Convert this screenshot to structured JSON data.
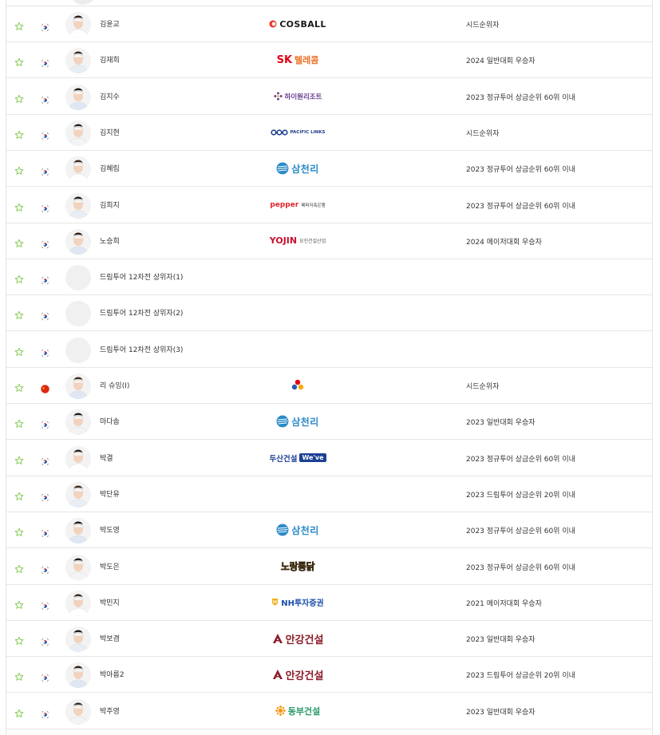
{
  "colors": {
    "border": "#e6e6e6",
    "star_green": "#7cc94a",
    "korea_red": "#cd2e3a",
    "korea_blue": "#0047a0",
    "china_red": "#de2910"
  },
  "players": [
    {
      "name": "김윤교",
      "flag": "korea",
      "avatar": "photo",
      "sponsor": {
        "logo": "cosball",
        "text": "COSBALL",
        "color": "#1a1a1a",
        "accent": "#e6332a"
      },
      "qualification": "시드순위자"
    },
    {
      "name": "김재희",
      "flag": "korea",
      "avatar": "photo",
      "sponsor": {
        "logo": "sk-telecom",
        "text": "텔레콤",
        "prefix": "SK",
        "color": "#ea7125",
        "accent": "#e50012"
      },
      "qualification": "2024 일반대회 우승자"
    },
    {
      "name": "김지수",
      "flag": "korea",
      "avatar": "photo",
      "sponsor": {
        "logo": "high1",
        "text": "하이원리조트",
        "color": "#6b3d8f",
        "accent": "#6b3d8f"
      },
      "qualification": "2023 정규투어 상금순위 60위 이내"
    },
    {
      "name": "김지현",
      "flag": "korea",
      "avatar": "photo",
      "sponsor": {
        "logo": "pacific-links",
        "text": "PACIFIC LINKS",
        "color": "#1e3f8a",
        "accent": "#1e3f8a"
      },
      "qualification": "시드순위자"
    },
    {
      "name": "김혜림",
      "flag": "korea",
      "avatar": "photo",
      "sponsor": {
        "logo": "samchully",
        "text": "삼천리",
        "color": "#2a8bc8",
        "accent": "#2a8bc8"
      },
      "qualification": "2023 정규투어 상금순위 60위 이내"
    },
    {
      "name": "김희지",
      "flag": "korea",
      "avatar": "photo",
      "sponsor": {
        "logo": "pepper",
        "text": "pepper",
        "suffix": "페퍼저축은행",
        "color": "#e0262d",
        "accent": "#333333"
      },
      "qualification": "2023 정규투어 상금순위 60위 이내"
    },
    {
      "name": "노승희",
      "flag": "korea",
      "avatar": "photo",
      "sponsor": {
        "logo": "yojin",
        "text": "YOJIN",
        "suffix": "요진건설산업",
        "color": "#c8102e",
        "accent": "#555555"
      },
      "qualification": "2024 메이저대회 우승자"
    },
    {
      "name": "드림투어 12차전 상위자(1)",
      "flag": "korea",
      "avatar": "blank",
      "sponsor": {
        "logo": "none",
        "text": ""
      },
      "qualification": ""
    },
    {
      "name": "드림투어 12차전 상위자(2)",
      "flag": "korea",
      "avatar": "blank",
      "sponsor": {
        "logo": "none",
        "text": ""
      },
      "qualification": ""
    },
    {
      "name": "드림투어 12차전 상위자(3)",
      "flag": "korea",
      "avatar": "blank",
      "sponsor": {
        "logo": "none",
        "text": ""
      },
      "qualification": ""
    },
    {
      "name": "리 슈잉(I)",
      "flag": "china",
      "avatar": "photo",
      "sponsor": {
        "logo": "cj",
        "text": "",
        "color": "#e50012",
        "accent": "#f9a800"
      },
      "qualification": "시드순위자"
    },
    {
      "name": "마다솜",
      "flag": "korea",
      "avatar": "photo",
      "sponsor": {
        "logo": "samchully",
        "text": "삼천리",
        "color": "#2a8bc8",
        "accent": "#2a8bc8"
      },
      "qualification": "2023 일반대회 우승자"
    },
    {
      "name": "박결",
      "flag": "korea",
      "avatar": "photo",
      "sponsor": {
        "logo": "doosan-weve",
        "text": "두산건설",
        "suffix": "We've",
        "color": "#1c3f94",
        "accent": "#1c3f94"
      },
      "qualification": "2023 정규투어 상금순위 60위 이내"
    },
    {
      "name": "박단유",
      "flag": "korea",
      "avatar": "photo",
      "sponsor": {
        "logo": "none",
        "text": ""
      },
      "qualification": "2023 드림투어 상금순위 20위 이내"
    },
    {
      "name": "박도영",
      "flag": "korea",
      "avatar": "photo",
      "sponsor": {
        "logo": "samchully",
        "text": "삼천리",
        "color": "#2a8bc8",
        "accent": "#2a8bc8"
      },
      "qualification": "2023 정규투어 상금순위 60위 이내"
    },
    {
      "name": "박도은",
      "flag": "korea",
      "avatar": "photo",
      "sponsor": {
        "logo": "noranggotong",
        "text": "노랑통닭",
        "color": "#f6d21e",
        "accent": "#3a2a10"
      },
      "qualification": "2023 정규투어 상금순위 60위 이내"
    },
    {
      "name": "박민지",
      "flag": "korea",
      "avatar": "photo",
      "sponsor": {
        "logo": "nh",
        "text": "NH투자증권",
        "color": "#1a4ea8",
        "accent": "#f2b01e"
      },
      "qualification": "2021 메이저대회 우승자"
    },
    {
      "name": "박보겸",
      "flag": "korea",
      "avatar": "photo",
      "sponsor": {
        "logo": "ankang",
        "text": "안강건설",
        "color": "#8c1c2a",
        "accent": "#8c1c2a"
      },
      "qualification": "2023 일반대회 우승자"
    },
    {
      "name": "박아름2",
      "flag": "korea",
      "avatar": "photo",
      "sponsor": {
        "logo": "ankang",
        "text": "안강건설",
        "color": "#8c1c2a",
        "accent": "#8c1c2a"
      },
      "qualification": "2023 드림투어 상금순위 20위 이내"
    },
    {
      "name": "박주영",
      "flag": "korea",
      "avatar": "photo",
      "sponsor": {
        "logo": "dongbu",
        "text": "동부건설",
        "color": "#2a9a6a",
        "accent": "#f59b1c"
      },
      "qualification": "2023 일반대회 우승자"
    }
  ]
}
